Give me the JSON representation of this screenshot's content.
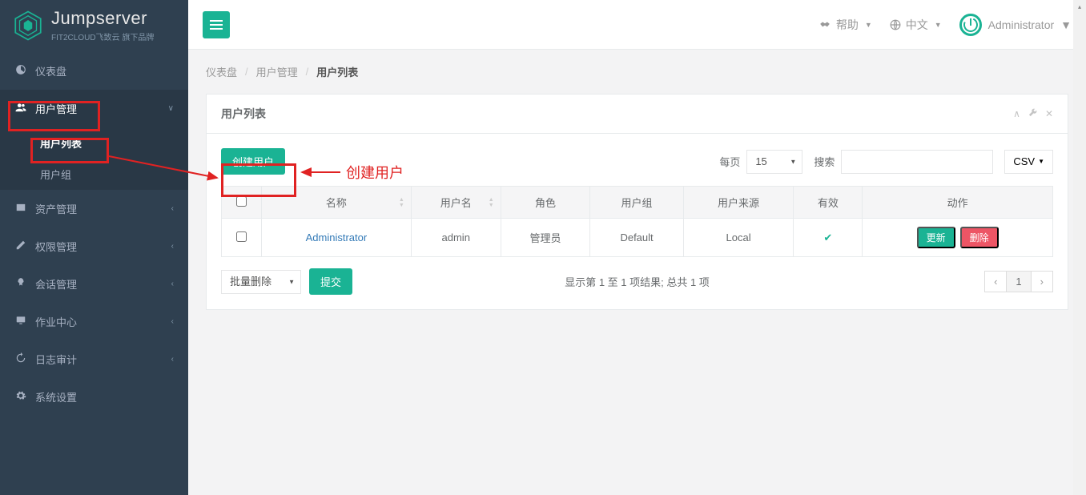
{
  "brand": {
    "title": "Jumpserver",
    "subtitle": "FIT2CLOUD飞致云 旗下品牌"
  },
  "sidebar": {
    "items": [
      {
        "label": "仪表盘",
        "icon": "dashboard"
      },
      {
        "label": "用户管理",
        "icon": "users",
        "open": true
      },
      {
        "label": "资产管理",
        "icon": "assets"
      },
      {
        "label": "权限管理",
        "icon": "perm"
      },
      {
        "label": "会话管理",
        "icon": "session"
      },
      {
        "label": "作业中心",
        "icon": "jobs"
      },
      {
        "label": "日志审计",
        "icon": "logs"
      },
      {
        "label": "系统设置",
        "icon": "settings"
      }
    ],
    "sub": [
      {
        "label": "用户列表",
        "active": true
      },
      {
        "label": "用户组",
        "active": false
      }
    ]
  },
  "topbar": {
    "help": "帮助",
    "lang": "中文",
    "user": "Administrator"
  },
  "breadcrumb": {
    "a": "仪表盘",
    "b": "用户管理",
    "c": "用户列表"
  },
  "panel": {
    "title": "用户列表"
  },
  "toolbar": {
    "create_btn": "创建用户",
    "annotation": "创建用户",
    "per_page_label": "每页",
    "per_page_value": "15",
    "search_label": "搜索",
    "csv_btn": "CSV"
  },
  "table": {
    "headers": {
      "name": "名称",
      "username": "用户名",
      "role": "角色",
      "group": "用户组",
      "source": "用户来源",
      "valid": "有效",
      "action": "动作"
    },
    "rows": [
      {
        "name": "Administrator",
        "username": "admin",
        "role": "管理员",
        "group": "Default",
        "source": "Local"
      }
    ],
    "actions": {
      "update": "更新",
      "delete": "删除"
    }
  },
  "footer": {
    "bulk_label": "批量删除",
    "submit": "提交",
    "info": "显示第 1 至 1 项结果; 总共 1 项",
    "page": "1",
    "prev": "‹",
    "next": "›"
  }
}
